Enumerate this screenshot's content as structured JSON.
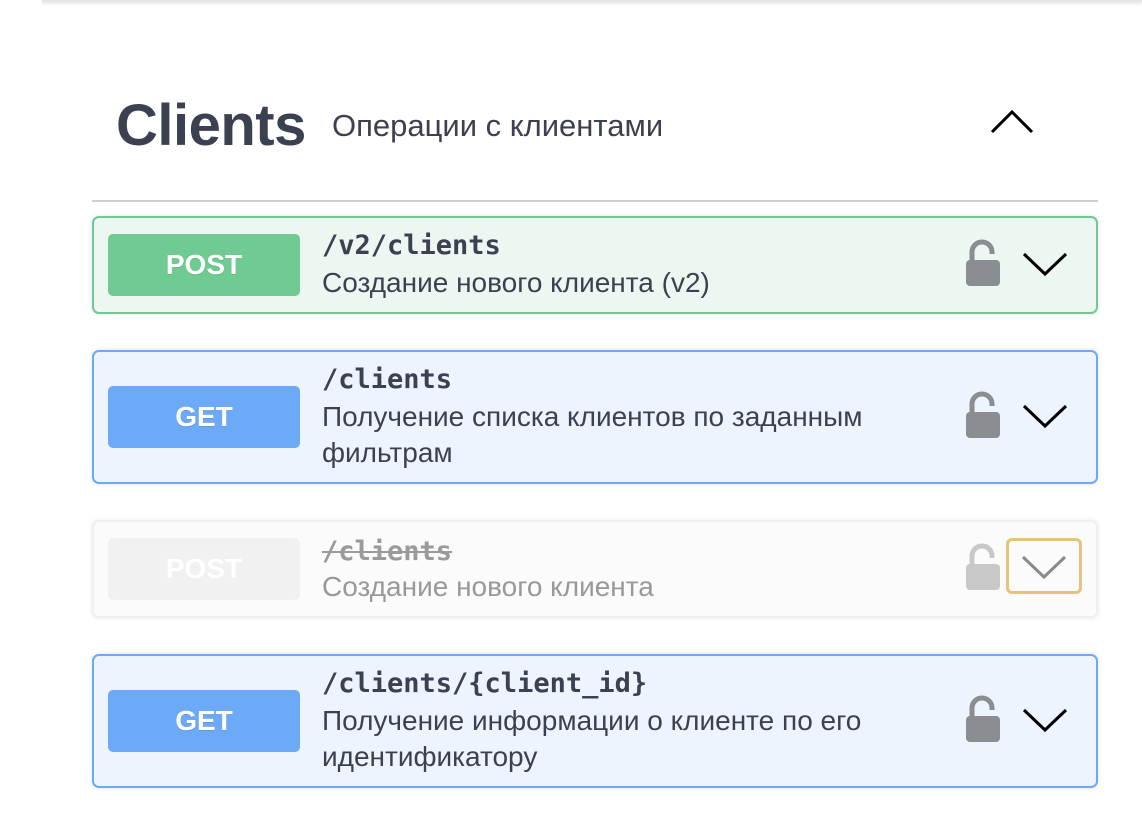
{
  "tag": {
    "name": "Clients",
    "description": "Операции с клиентами",
    "expanded": true
  },
  "operations": [
    {
      "method": "POST",
      "path": "/v2/clients",
      "summary": "Создание нового клиента (v2)",
      "deprecated": false,
      "lock_icon": "unlocked-padlock-icon",
      "toggle_icon": "chevron-down-icon"
    },
    {
      "method": "GET",
      "path": "/clients",
      "summary": "Получение списка клиентов по заданным фильтрам",
      "deprecated": false,
      "lock_icon": "unlocked-padlock-icon",
      "toggle_icon": "chevron-down-icon"
    },
    {
      "method": "POST",
      "path": "/clients",
      "summary": "Создание нового клиента",
      "deprecated": true,
      "lock_icon": "unlocked-padlock-icon",
      "toggle_icon": "chevron-down-icon",
      "toggle_focused": true
    },
    {
      "method": "GET",
      "path": "/clients/{client_id}",
      "summary": "Получение информации о клиенте по его идентификатору",
      "deprecated": false,
      "lock_icon": "unlocked-padlock-icon",
      "toggle_icon": "chevron-down-icon"
    }
  ],
  "colors": {
    "post": "#49cc90",
    "get": "#61affe",
    "text": "#3b4151",
    "focus_ring": "#e5c37f"
  }
}
